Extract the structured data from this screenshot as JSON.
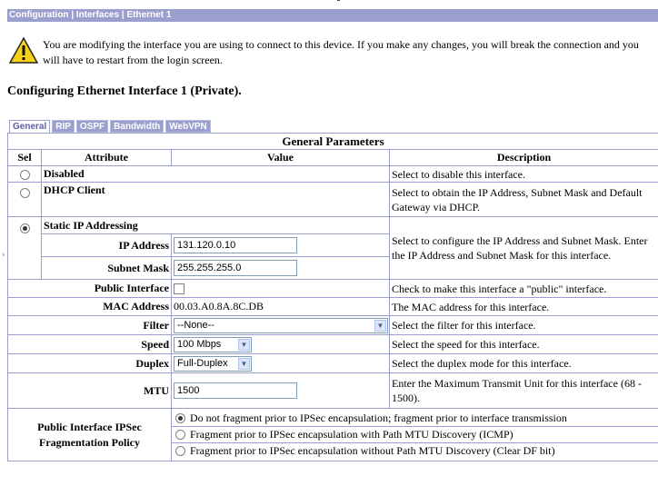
{
  "breadcrumb": "Configuration | Interfaces | Ethernet 1",
  "warning": {
    "icon": "warning-triangle-icon",
    "text": "You are modifying the interface you are using to connect to this device. If you make any changes, you will break the connection and you will have to restart from the login screen."
  },
  "page_title": "Configuring Ethernet Interface 1 (Private).",
  "tabs": [
    "General",
    "RIP",
    "OSPF",
    "Bandwidth",
    "WebVPN"
  ],
  "table": {
    "title": "General Parameters",
    "headers": {
      "sel": "Sel",
      "attribute": "Attribute",
      "value": "Value",
      "description": "Description"
    },
    "disabled": {
      "label": "Disabled",
      "desc": "Select to disable this interface."
    },
    "dhcp": {
      "label": "DHCP Client",
      "desc": "Select to obtain the IP Address, Subnet Mask and Default Gateway via DHCP."
    },
    "static": {
      "label": "Static IP Addressing",
      "desc": "Select to configure the IP Address and Subnet Mask. Enter the IP Address and Subnet Mask for this interface.",
      "ip_label": "IP Address",
      "ip_value": "131.120.0.10",
      "mask_label": "Subnet Mask",
      "mask_value": "255.255.255.0"
    },
    "public": {
      "label": "Public Interface",
      "desc": "Check to make this interface a \"public\" interface."
    },
    "mac": {
      "label": "MAC Address",
      "value": "00.03.A0.8A.8C.DB",
      "desc": "The MAC address for this interface."
    },
    "filter": {
      "label": "Filter",
      "value": "--None--",
      "desc": "Select the filter for this interface."
    },
    "speed": {
      "label": "Speed",
      "value": "100 Mbps",
      "desc": "Select the speed for this interface."
    },
    "duplex": {
      "label": "Duplex",
      "value": "Full-Duplex",
      "desc": "Select the duplex mode for this interface."
    },
    "mtu": {
      "label": "MTU",
      "value": "1500",
      "desc": "Enter the Maximum Transmit Unit for this interface (68 - 1500)."
    },
    "frag": {
      "label": "Public Interface IPSec Fragmentation Policy",
      "options": [
        "Do not fragment prior to IPSec encapsulation; fragment prior to interface transmission",
        "Fragment prior to IPSec encapsulation with Path MTU Discovery (ICMP)",
        "Fragment prior to IPSec encapsulation without Path MTU Discovery (Clear DF bit)"
      ]
    }
  },
  "stray_mark": "›",
  "colors": {
    "header_bar": "#9b9fce",
    "tab_text_active": "#5b5f9f",
    "border": "#9b9fce"
  }
}
